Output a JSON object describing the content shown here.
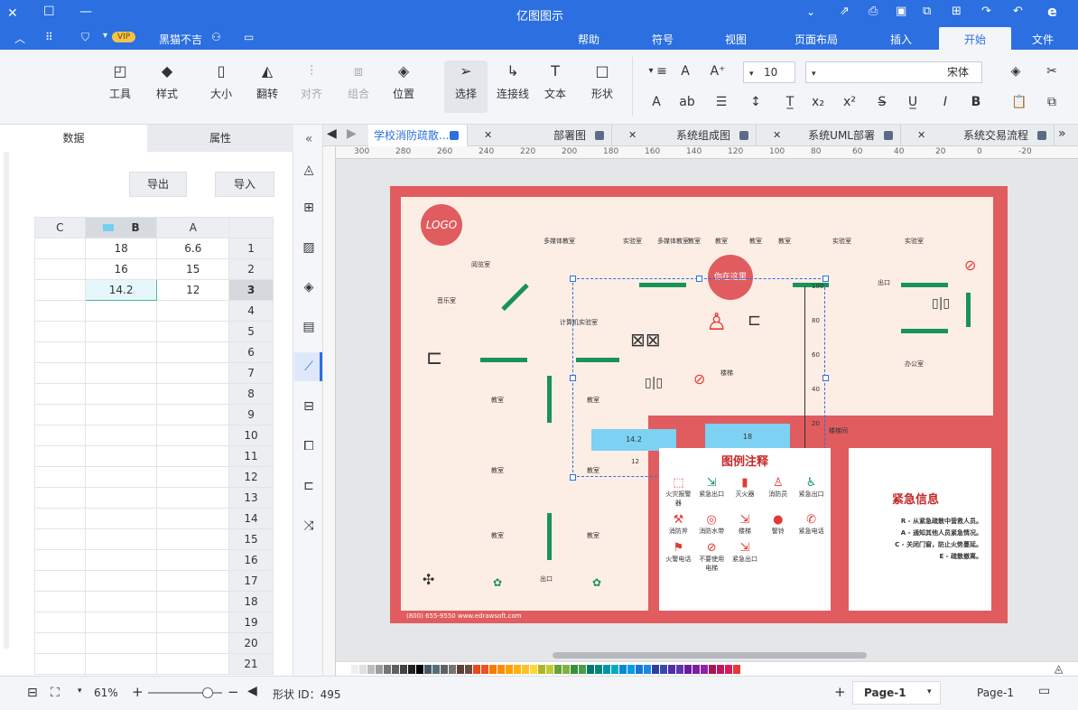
{
  "window": {
    "title": "亿图图示"
  },
  "titlebar_right_icons": [
    "logo-icon",
    "minimize-icon",
    "restore-icon",
    "close-icon"
  ],
  "menu_tabs": [
    {
      "label": "文件"
    },
    {
      "label": "开始"
    },
    {
      "label": "插入"
    },
    {
      "label": "页面布局"
    },
    {
      "label": "视图"
    },
    {
      "label": "符号"
    },
    {
      "label": "帮助"
    }
  ],
  "user": {
    "name": "黑猫不吉",
    "badge": "VIP"
  },
  "ribbon": {
    "font_name": "宋体",
    "font_size": "10",
    "tools": {
      "shape": "形状",
      "text": "文本",
      "connector": "连接线",
      "select": "选择",
      "position": "位置",
      "group": "组合",
      "align": "对齐",
      "rotate": "翻转",
      "size": "大小",
      "style": "样式",
      "tools": "工具"
    }
  },
  "left_panel": {
    "tabs": [
      {
        "label": "属性"
      },
      {
        "label": "数据"
      }
    ],
    "buttons": {
      "import": "导入",
      "export": "导出"
    },
    "columns": [
      "A",
      "B",
      "C"
    ],
    "rows": [
      {
        "n": "1",
        "a": "6.6",
        "b": "18",
        "c": ""
      },
      {
        "n": "2",
        "a": "15",
        "b": "16",
        "c": ""
      },
      {
        "n": "3",
        "a": "12",
        "b": "14.2",
        "c": ""
      },
      {
        "n": "4"
      },
      {
        "n": "5"
      },
      {
        "n": "6"
      },
      {
        "n": "7"
      },
      {
        "n": "8"
      },
      {
        "n": "9"
      },
      {
        "n": "10"
      },
      {
        "n": "11"
      },
      {
        "n": "12"
      },
      {
        "n": "13"
      },
      {
        "n": "14"
      },
      {
        "n": "15"
      },
      {
        "n": "16"
      },
      {
        "n": "17"
      },
      {
        "n": "18"
      },
      {
        "n": "19"
      },
      {
        "n": "20"
      },
      {
        "n": "21"
      }
    ]
  },
  "doc_tabs": [
    {
      "label": "系统交易流程"
    },
    {
      "label": "系统UML部署"
    },
    {
      "label": "系统组成图"
    },
    {
      "label": "部署图"
    },
    {
      "label": "学校消防疏散..."
    }
  ],
  "ruler_h": [
    "-20",
    "0",
    "20",
    "40",
    "60",
    "80",
    "100",
    "120",
    "140",
    "160",
    "180",
    "200",
    "220",
    "240",
    "260",
    "280",
    "300"
  ],
  "floorplan": {
    "title_legend": "图例注释",
    "emergency_title": "紧急信息",
    "emergency_lines": [
      "R - 从紧急疏散中营救人员。",
      "A - 通知其他人员紧急情况。",
      "C - 关闭门窗，防止火势蔓延。",
      "E - 疏散撤离。"
    ],
    "footer": "(800) 655-9550 www.edrawsoft.com",
    "logo": "LOGO",
    "bubble": "你在这里",
    "rooms": [
      "实验室",
      "多媒体教室",
      "教室",
      "教室",
      "教室",
      "实验室",
      "实验室",
      "阅览室",
      "音乐室",
      "计算机实验室",
      "办公室",
      "楼梯",
      "教室",
      "教室",
      "教室",
      "教室",
      "出口",
      "出口",
      "出口",
      "楼梯间"
    ],
    "legend_items": [
      "火灾报警器",
      "紧急出口",
      "灭火器",
      "消防员",
      "紧急出口",
      "消防斧",
      "消防水带",
      "楼梯",
      "警铃",
      "紧急电话",
      "火警电话",
      "不要使用电梯",
      "紧急出口"
    ],
    "chart_values": {
      "series": [
        "14.2",
        "16",
        "18"
      ],
      "axis": [
        "0",
        "20",
        "40",
        "60",
        "80",
        "100"
      ],
      "labels": [
        "12",
        "15",
        "18"
      ]
    }
  },
  "palette_colors": [
    "#e53935",
    "#d81b60",
    "#c2185b",
    "#ad1457",
    "#8e24aa",
    "#7b1fa2",
    "#6a1b9a",
    "#5e35b1",
    "#512da8",
    "#3949ab",
    "#303f9f",
    "#1e88e5",
    "#1976d2",
    "#039be5",
    "#0288d1",
    "#00acc1",
    "#0097a7",
    "#00897b",
    "#00796b",
    "#43a047",
    "#388e3c",
    "#7cb342",
    "#689f38",
    "#c0ca33",
    "#afb42b",
    "#fdd835",
    "#fbc02d",
    "#ffb300",
    "#ffa000",
    "#fb8c00",
    "#f57c00",
    "#f4511e",
    "#e64a19",
    "#6d4c41",
    "#5d4037",
    "#757575",
    "#616161",
    "#546e7a",
    "#455a64",
    "#000000",
    "#212121",
    "#424242",
    "#616161",
    "#757575",
    "#9e9e9e",
    "#bdbdbd",
    "#e0e0e0",
    "#eeeeee",
    "#ffffff"
  ],
  "status": {
    "page_name": "Page-1",
    "page_tab": "Page-1",
    "shape_id": "形状 ID：495",
    "zoom": "61%"
  }
}
